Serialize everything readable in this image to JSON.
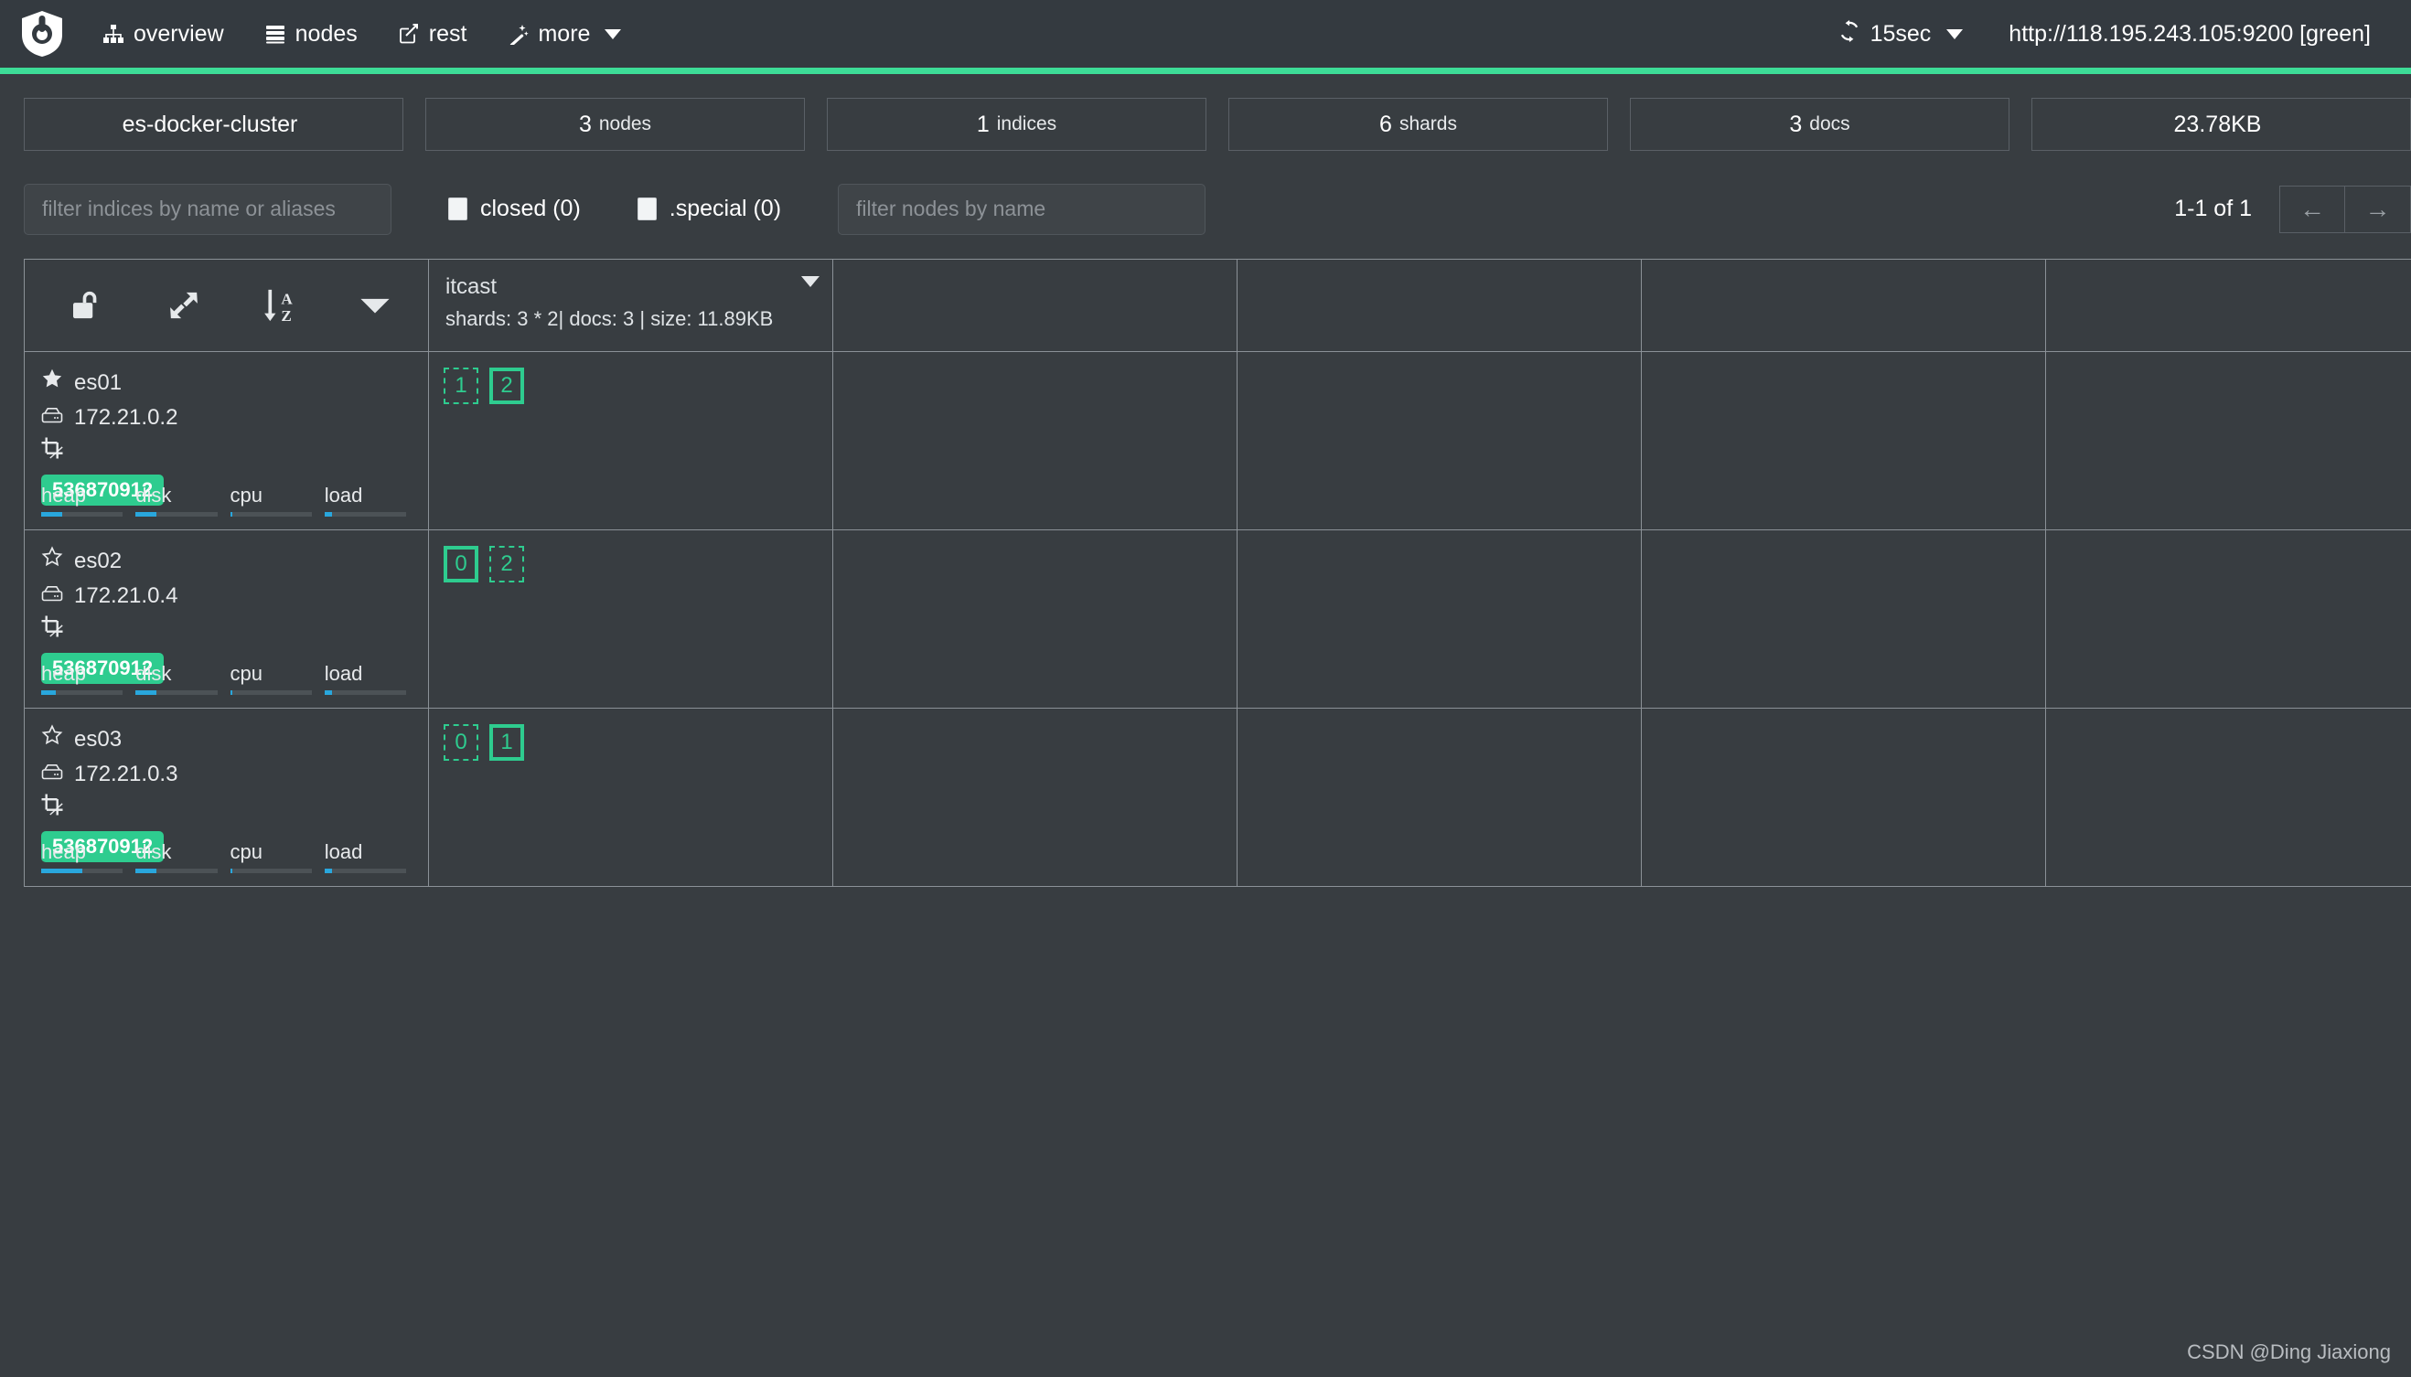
{
  "navbar": {
    "brand_icon": "elasticsearch-head-logo-icon",
    "items": [
      {
        "label": "overview",
        "icon": "sitemap-icon"
      },
      {
        "label": "nodes",
        "icon": "server-stack-icon"
      },
      {
        "label": "rest",
        "icon": "edit-square-icon"
      },
      {
        "label": "more",
        "icon": "magic-wand-icon",
        "has_caret": true
      }
    ],
    "refresh": {
      "icon": "refresh-icon",
      "label": "15sec",
      "has_caret": true
    },
    "cluster_url": "http://118.195.243.105:9200 [green]",
    "accent_color": "#3ddc97",
    "bg_color": "#343a40"
  },
  "stats": [
    {
      "value": "es-docker-cluster",
      "unit": ""
    },
    {
      "value": "3",
      "unit": "nodes"
    },
    {
      "value": "1",
      "unit": "indices"
    },
    {
      "value": "6",
      "unit": "shards"
    },
    {
      "value": "3",
      "unit": "docs"
    },
    {
      "value": "23.78KB",
      "unit": ""
    }
  ],
  "filters": {
    "indices_placeholder": "filter indices by name or aliases",
    "indices_value": "",
    "closed_label": "closed (0)",
    "closed_checked": false,
    "special_label": ".special (0)",
    "special_checked": false,
    "nodes_placeholder": "filter nodes by name",
    "nodes_value": "",
    "pager_label": "1-1 of 1",
    "pager_prev": "←",
    "pager_next": "→"
  },
  "table": {
    "tools": [
      {
        "name": "unlock-icon",
        "title": "unlock"
      },
      {
        "name": "expand-arrows-icon",
        "title": "expand"
      },
      {
        "name": "sort-alpha-asc-icon",
        "title": "sort a-z"
      },
      {
        "name": "chevron-down-icon",
        "title": "menu"
      }
    ],
    "index": {
      "name": "itcast",
      "meta": "shards: 3 * 2| docs: 3 | size: 11.89KB"
    },
    "empty_columns": 4,
    "nodes": [
      {
        "name": "es01",
        "master": true,
        "star_icon": "star-filled-icon",
        "ip_icon": "hdd-icon",
        "ip": "172.21.0.2",
        "action_icon": "crop-icon",
        "badge": "536870912",
        "meters": [
          {
            "label": "heap",
            "pct": 26
          },
          {
            "label": "disk",
            "pct": 26
          },
          {
            "label": "cpu",
            "pct": 3
          },
          {
            "label": "load",
            "pct": 9
          }
        ],
        "shards": [
          {
            "id": "1",
            "type": "replica"
          },
          {
            "id": "2",
            "type": "primary"
          }
        ]
      },
      {
        "name": "es02",
        "master": false,
        "star_icon": "star-outline-icon",
        "ip_icon": "hdd-icon",
        "ip": "172.21.0.4",
        "action_icon": "crop-icon",
        "badge": "536870912",
        "meters": [
          {
            "label": "heap",
            "pct": 18
          },
          {
            "label": "disk",
            "pct": 26
          },
          {
            "label": "cpu",
            "pct": 3
          },
          {
            "label": "load",
            "pct": 9
          }
        ],
        "shards": [
          {
            "id": "0",
            "type": "primary"
          },
          {
            "id": "2",
            "type": "replica"
          }
        ]
      },
      {
        "name": "es03",
        "master": false,
        "star_icon": "star-outline-icon",
        "ip_icon": "hdd-icon",
        "ip": "172.21.0.3",
        "action_icon": "crop-icon",
        "badge": "536870912",
        "meters": [
          {
            "label": "heap",
            "pct": 50
          },
          {
            "label": "disk",
            "pct": 26
          },
          {
            "label": "cpu",
            "pct": 3
          },
          {
            "label": "load",
            "pct": 9
          }
        ],
        "shards": [
          {
            "id": "0",
            "type": "replica"
          },
          {
            "id": "1",
            "type": "primary"
          }
        ]
      }
    ]
  },
  "watermark": "CSDN @Ding Jiaxiong"
}
